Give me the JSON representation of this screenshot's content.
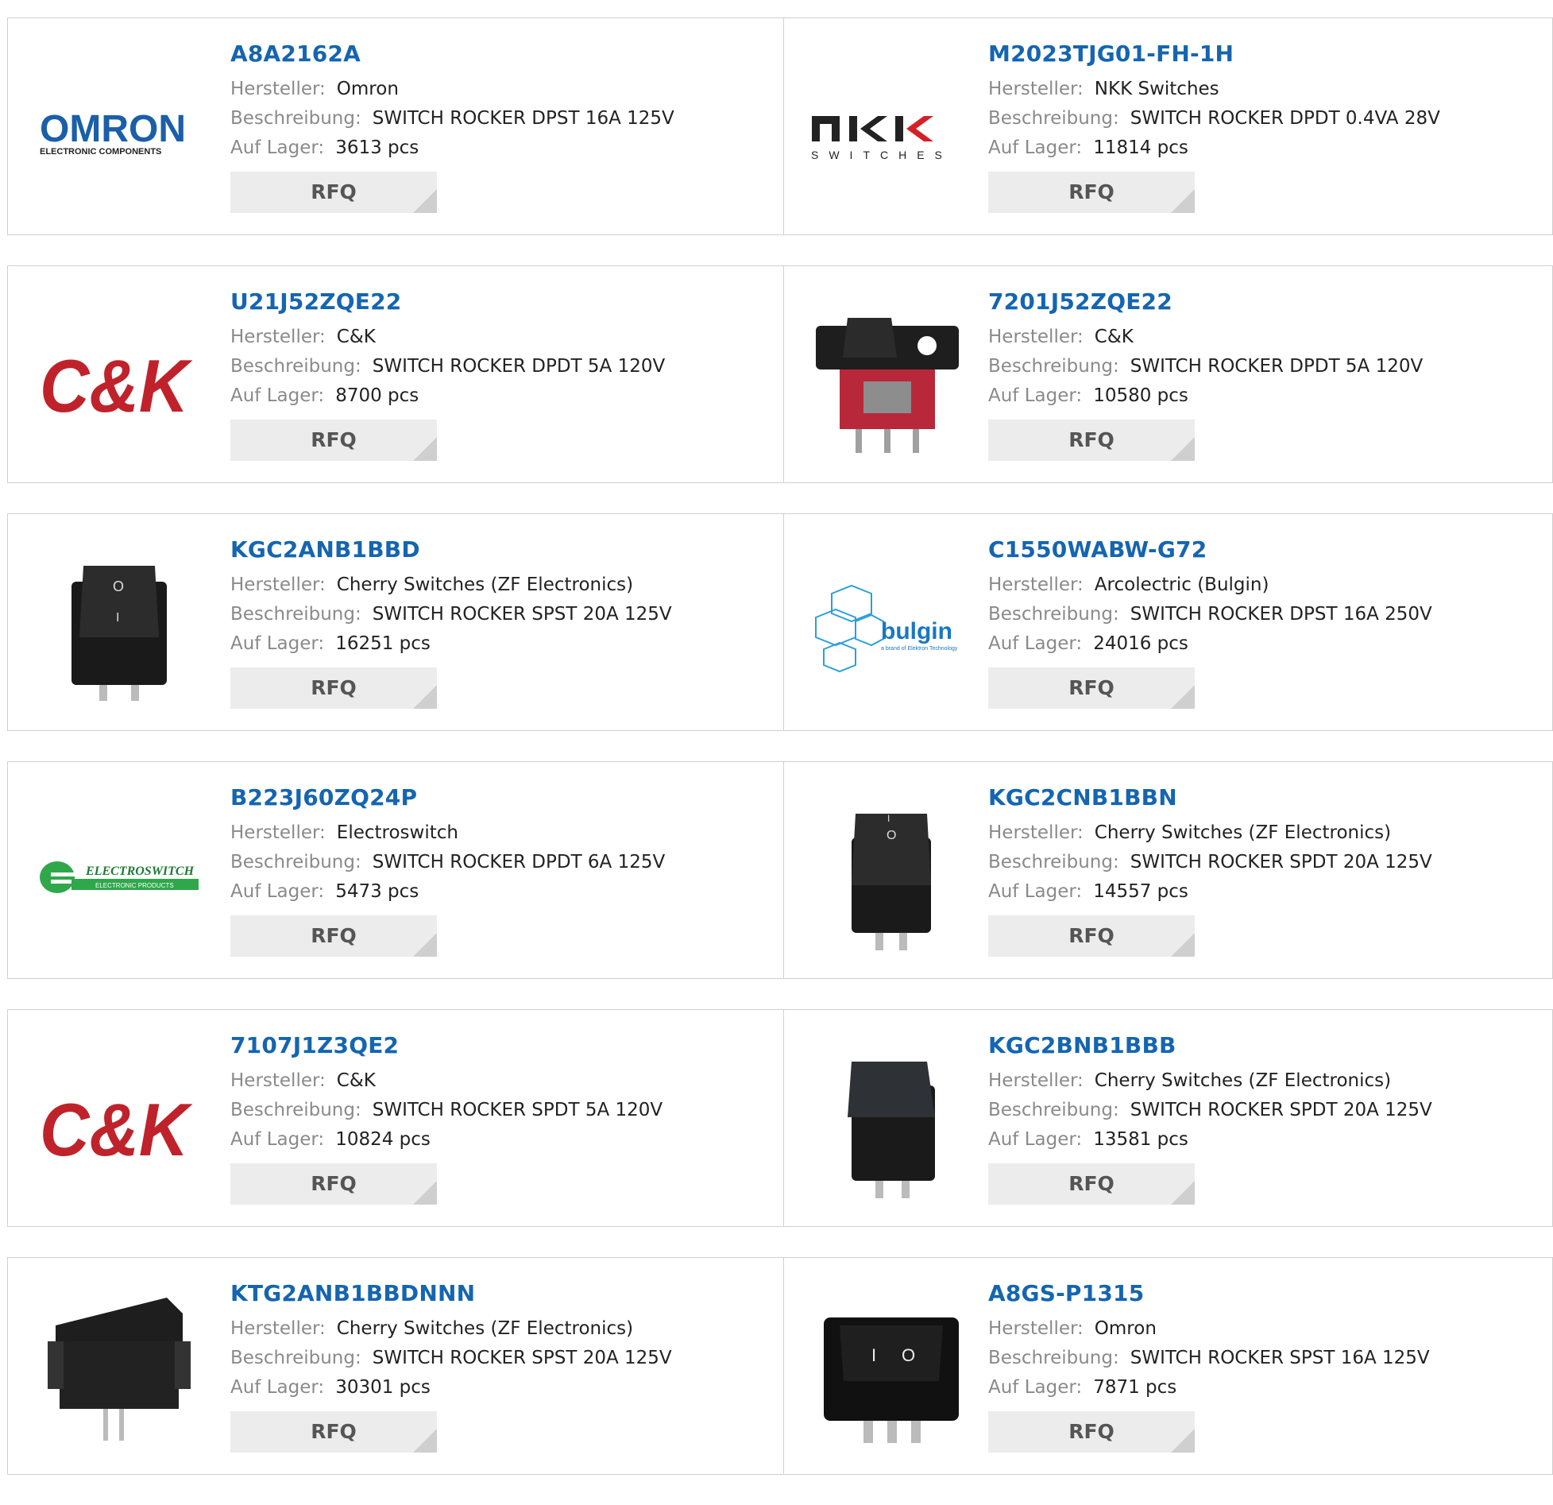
{
  "labels": {
    "manufacturer": "Hersteller:",
    "description": "Beschreibung:",
    "stock": "Auf Lager:",
    "rfq": "RFQ"
  },
  "products": [
    {
      "part": "A8A2162A",
      "manufacturer": "Omron",
      "description": "SWITCH ROCKER DPST 16A 125V",
      "stock": "3613 pcs",
      "image": "omron-logo"
    },
    {
      "part": "M2023TJG01-FH-1H",
      "manufacturer": "NKK Switches",
      "description": "SWITCH ROCKER DPDT 0.4VA 28V",
      "stock": "11814 pcs",
      "image": "nkk-logo"
    },
    {
      "part": "U21J52ZQE22",
      "manufacturer": "C&K",
      "description": "SWITCH ROCKER DPDT 5A 120V",
      "stock": "8700 pcs",
      "image": "ck-logo"
    },
    {
      "part": "7201J52ZQE22",
      "manufacturer": "C&K",
      "description": "SWITCH ROCKER DPDT 5A 120V",
      "stock": "10580 pcs",
      "image": "red-rocker-switch-photo"
    },
    {
      "part": "KGC2ANB1BBD",
      "manufacturer": "Cherry Switches (ZF Electronics)",
      "description": "SWITCH ROCKER SPST 20A 125V",
      "stock": "16251 pcs",
      "image": "black-rocker-switch-photo"
    },
    {
      "part": "C1550WABW-G72",
      "manufacturer": "Arcolectric (Bulgin)",
      "description": "SWITCH ROCKER DPST 16A 250V",
      "stock": "24016 pcs",
      "image": "bulgin-logo"
    },
    {
      "part": "B223J60ZQ24P",
      "manufacturer": "Electroswitch",
      "description": "SWITCH ROCKER DPDT 6A 125V",
      "stock": "5473 pcs",
      "image": "electroswitch-logo"
    },
    {
      "part": "KGC2CNB1BBN",
      "manufacturer": "Cherry Switches (ZF Electronics)",
      "description": "SWITCH ROCKER SPDT 20A 125V",
      "stock": "14557 pcs",
      "image": "black-rocker-switch-photo"
    },
    {
      "part": "7107J1Z3QE2",
      "manufacturer": "C&K",
      "description": "SWITCH ROCKER SPDT 5A 120V",
      "stock": "10824 pcs",
      "image": "ck-logo"
    },
    {
      "part": "KGC2BNB1BBB",
      "manufacturer": "Cherry Switches (ZF Electronics)",
      "description": "SWITCH ROCKER SPDT 20A 125V",
      "stock": "13581 pcs",
      "image": "black-rocker-switch-photo"
    },
    {
      "part": "KTG2ANB1BBDNNN",
      "manufacturer": "Cherry Switches (ZF Electronics)",
      "description": "SWITCH ROCKER SPST 20A 125V",
      "stock": "30301 pcs",
      "image": "black-rocker-switch-photo"
    },
    {
      "part": "A8GS-P1315",
      "manufacturer": "Omron",
      "description": "SWITCH ROCKER SPST 16A 125V",
      "stock": "7871 pcs",
      "image": "black-rocker-switch-photo"
    }
  ],
  "logos": {
    "omron": {
      "main": "OMRON",
      "sub": "ELECTRONIC COMPONENTS"
    },
    "nkk": {
      "main": "nkk",
      "sub": "SWITCHES"
    },
    "ck": {
      "main": "C&K"
    },
    "bulgin": {
      "main": "bulgin",
      "sub": "a brand of Elektron Technology"
    },
    "electroswitch": {
      "main": "ELECTROSWITCH",
      "sub": "ELECTRONIC PRODUCTS"
    },
    "switch_symbols": {
      "on": "I",
      "off": "O"
    }
  },
  "colors": {
    "link": "#1565b0",
    "ck_red": "#c0222b",
    "omron_blue": "#1a5fa8",
    "bulgin_blue": "#2aa0d8",
    "electroswitch_green": "#2ea84a"
  }
}
